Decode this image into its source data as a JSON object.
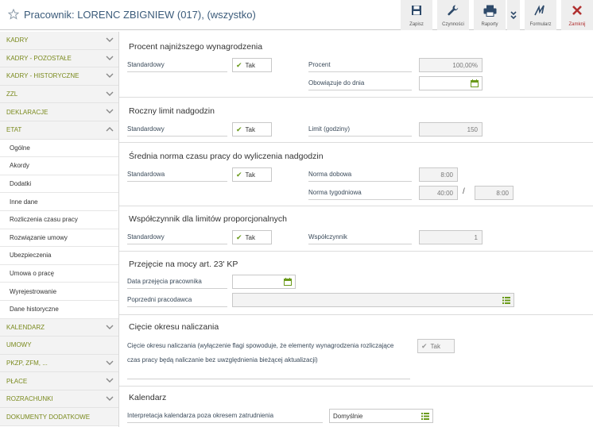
{
  "header": {
    "title": "Pracownik: LORENC ZBIGNIEW (017), (wszystko)",
    "toolbar": [
      {
        "label": "Zapisz",
        "icon": "save-icon"
      },
      {
        "label": "Czynności",
        "icon": "wrench-icon"
      },
      {
        "label": "Raporty",
        "icon": "printer-icon"
      },
      {
        "label": "Formularz",
        "icon": "signature-icon"
      },
      {
        "label": "Zamknij",
        "icon": "close-icon"
      }
    ]
  },
  "sidebar": {
    "top_items": [
      "KADRY",
      "KADRY - POZOSTAŁE",
      "KADRY - HISTORYCZNE",
      "ZZL",
      "DEKLARACJE",
      "ETAT"
    ],
    "sub_items": [
      "Ogólne",
      "Akordy",
      "Dodatki",
      "Inne dane",
      "Rozliczenia czasu pracy",
      "Rozwiązanie umowy",
      "Ubezpieczenia",
      "Umowa o pracę",
      "Wyrejestrowanie",
      "Dane historyczne"
    ],
    "bottom_items": [
      "KALENDARZ",
      "UMOWY",
      "PKZP, ZFM, ...",
      "PŁACE",
      "ROZRACHUNKI",
      "DOKUMENTY DODATKOWE"
    ]
  },
  "sections": {
    "s1": {
      "title": "Procent najniższego wynagrodzenia",
      "std_label": "Standardowy",
      "std_value": "Tak",
      "percent_label": "Procent",
      "percent_value": "100,00%",
      "valid_label": "Obowiązuje do dnia"
    },
    "s2": {
      "title": "Roczny limit nadgodzin",
      "std_label": "Standardowy",
      "std_value": "Tak",
      "limit_label": "Limit (godziny)",
      "limit_value": "150"
    },
    "s3": {
      "title": "Średnia norma czasu pracy do wyliczenia nadgodzin",
      "std_label": "Standardowa",
      "std_value": "Tak",
      "daily_label": "Norma dobowa",
      "daily_value": "8:00",
      "weekly_label": "Norma tygodniowa",
      "weekly_value": "40:00",
      "weekly_sep": "/",
      "weekly_value2": "8:00"
    },
    "s4": {
      "title": "Współczynnik dla limitów proporcjonalnych",
      "std_label": "Standardowy",
      "std_value": "Tak",
      "coef_label": "Współczynnik",
      "coef_value": "1"
    },
    "s5": {
      "title": "Przejęcie na mocy art. 23' KP",
      "date_label": "Data przejęcia pracownika",
      "prev_label": "Poprzedni pracodawca"
    },
    "s6": {
      "title": "Cięcie okresu naliczania",
      "desc_line1": "Cięcie okresu naliczania (wyłączenie flagi spowoduje, że elementy wynagrodzenia rozliczające",
      "desc_line2": "czas pracy będą naliczanie bez uwzględnienia bieżącej aktualizacji)",
      "value": "Tak"
    },
    "s7": {
      "title": "Kalendarz",
      "interp_label": "Interpretacja kalendarza poza okresem zatrudnienia",
      "interp_value": "Domyślnie"
    }
  },
  "colors": {
    "sidebar_text": "#7a8a1d",
    "check": "#6a9a1a",
    "title": "#3b5b7a",
    "close": "#b03030"
  }
}
